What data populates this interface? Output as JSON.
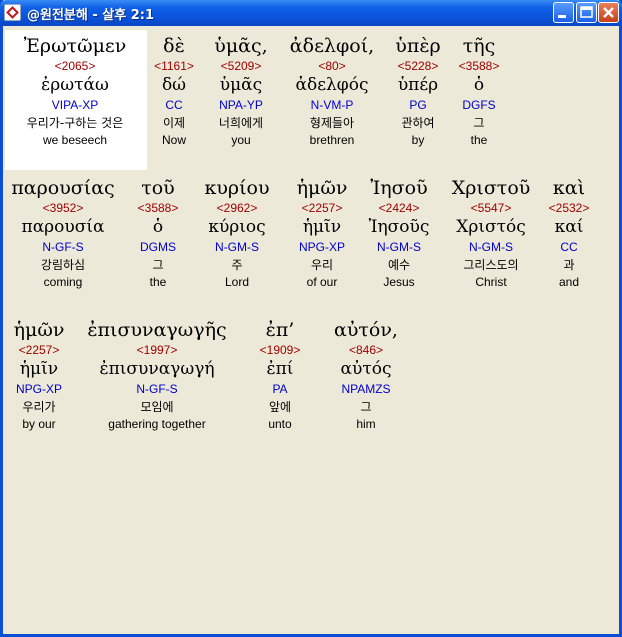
{
  "window": {
    "title": "@원전분해 - 살후 2:1"
  },
  "rows": [
    {
      "words": [
        {
          "greek": "Ἐρωτῶμεν",
          "strong": "<2065>",
          "lemma": "ἐρωτάω",
          "parse": "VIPA-XP",
          "korean": "우리가-구하는 것은",
          "english": "we beseech"
        },
        {
          "greek": "δὲ",
          "strong": "<1161>",
          "lemma": "δώ",
          "parse": "CC",
          "korean": "이제",
          "english": "Now"
        },
        {
          "greek": "ὑμᾶς,",
          "strong": "<5209>",
          "lemma": "ὑμᾶς",
          "parse": "NPA-YP",
          "korean": "너희에게",
          "english": "you"
        },
        {
          "greek": "ἀδελφοί,",
          "strong": "<80>",
          "lemma": "ἀδελφός",
          "parse": "N-VM-P",
          "korean": "형제들아",
          "english": "brethren"
        },
        {
          "greek": "ὑπὲρ",
          "strong": "<5228>",
          "lemma": "ὑπέρ",
          "parse": "PG",
          "korean": "관하여",
          "english": "by"
        },
        {
          "greek": "τῆς",
          "strong": "<3588>",
          "lemma": "ὁ",
          "parse": "DGFS",
          "korean": "그",
          "english": "the"
        }
      ]
    },
    {
      "words": [
        {
          "greek": "παρουσίας",
          "strong": "<3952>",
          "lemma": "παρουσία",
          "parse": "N-GF-S",
          "korean": "강림하심",
          "english": "coming"
        },
        {
          "greek": "τοῦ",
          "strong": "<3588>",
          "lemma": "ὁ",
          "parse": "DGMS",
          "korean": "그",
          "english": "the"
        },
        {
          "greek": "κυρίου",
          "strong": "<2962>",
          "lemma": "κύριος",
          "parse": "N-GM-S",
          "korean": "주",
          "english": "Lord"
        },
        {
          "greek": "ἡμῶν",
          "strong": "<2257>",
          "lemma": "ἡμῖν",
          "parse": "NPG-XP",
          "korean": "우리",
          "english": "of our"
        },
        {
          "greek": "Ἰησοῦ",
          "strong": "<2424>",
          "lemma": "Ἰησοῦς",
          "parse": "N-GM-S",
          "korean": "예수",
          "english": "Jesus"
        },
        {
          "greek": "Χριστοῦ",
          "strong": "<5547>",
          "lemma": "Χριστός",
          "parse": "N-GM-S",
          "korean": "그리스도의",
          "english": "Christ"
        },
        {
          "greek": "καὶ",
          "strong": "<2532>",
          "lemma": "καί",
          "parse": "CC",
          "korean": "과",
          "english": "and"
        }
      ]
    },
    {
      "words": [
        {
          "greek": "ἡμῶν",
          "strong": "<2257>",
          "lemma": "ἡμῖν",
          "parse": "NPG-XP",
          "korean": "우리가",
          "english": "by our"
        },
        {
          "greek": "ἐπισυναγωγῆς",
          "strong": "<1997>",
          "lemma": "ἐπισυναγωγή",
          "parse": "N-GF-S",
          "korean": "모임에",
          "english": "gathering together"
        },
        {
          "greek": "ἐπ’",
          "strong": "<1909>",
          "lemma": "ἐπί",
          "parse": "PA",
          "korean": "앞에",
          "english": "unto"
        },
        {
          "greek": "αὐτόν,",
          "strong": "<846>",
          "lemma": "αὐτός",
          "parse": "NPAMZS",
          "korean": "그",
          "english": "him"
        }
      ]
    }
  ]
}
